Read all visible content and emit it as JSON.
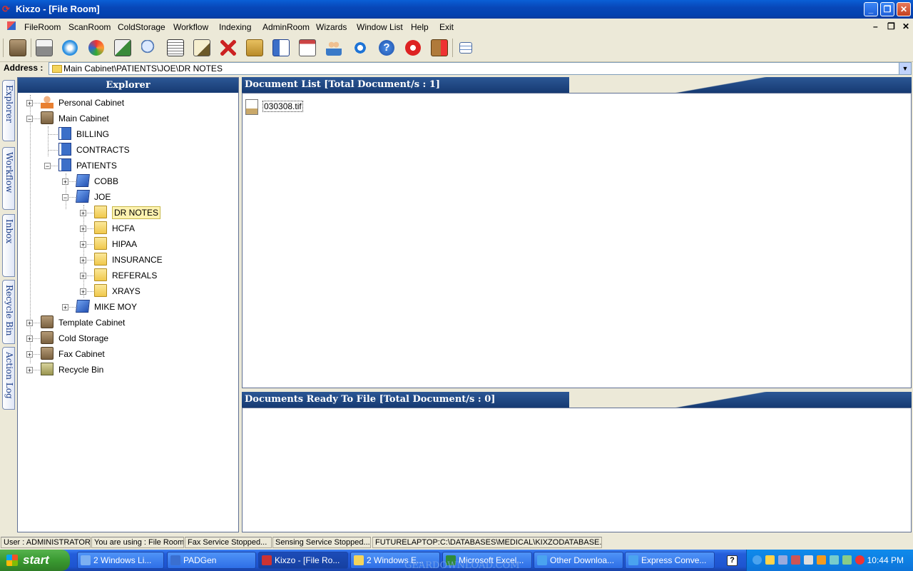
{
  "window": {
    "title": "Kixzo - [File Room]"
  },
  "menu": [
    "FileRoom",
    "ScanRoom",
    "ColdStorage",
    "Workflow",
    "Indexing",
    "AdminRoom",
    "Wizards",
    "Window List",
    "Help",
    "Exit"
  ],
  "address": {
    "label": "Address :",
    "value": "Main Cabinet\\PATIENTS\\JOE\\DR NOTES"
  },
  "side_tabs": [
    "Explorer",
    "Workflow",
    "Inbox",
    "Recycle Bin",
    "Action Log"
  ],
  "explorer": {
    "title": "Explorer",
    "nodes": [
      {
        "label": "Personal Cabinet",
        "icon": "person-icon"
      },
      {
        "label": "Main Cabinet",
        "icon": "cabinet-icon"
      },
      {
        "label": "BILLING",
        "icon": "drawer-icon"
      },
      {
        "label": "CONTRACTS",
        "icon": "drawer-icon"
      },
      {
        "label": "PATIENTS",
        "icon": "drawer-icon"
      },
      {
        "label": "COBB",
        "icon": "book-icon"
      },
      {
        "label": "JOE",
        "icon": "book-icon"
      },
      {
        "label": "DR NOTES",
        "icon": "folder-icon"
      },
      {
        "label": "HCFA",
        "icon": "folder-icon"
      },
      {
        "label": "HIPAA",
        "icon": "folder-icon"
      },
      {
        "label": "INSURANCE",
        "icon": "folder-icon"
      },
      {
        "label": "REFERALS",
        "icon": "folder-icon"
      },
      {
        "label": "XRAYS",
        "icon": "folder-icon"
      },
      {
        "label": "MIKE MOY",
        "icon": "book-icon"
      },
      {
        "label": "Template Cabinet",
        "icon": "cabinet-icon"
      },
      {
        "label": "Cold Storage",
        "icon": "cabinet-icon"
      },
      {
        "label": "Fax Cabinet",
        "icon": "cabinet-icon"
      },
      {
        "label": "Recycle Bin",
        "icon": "recycle-bin-icon"
      }
    ]
  },
  "document_list": {
    "title": "Document List  [Total Document/s : 1]",
    "files": [
      {
        "name": "030308.tif",
        "icon": "tif-file-icon"
      }
    ]
  },
  "ready_to_file": {
    "title": "Documents Ready To File  [Total Document/s : 0]"
  },
  "status": [
    "User : ADMINISTRATOR",
    "You are using : File Room",
    "Fax Service Stopped...",
    "Sensing Service Stopped...",
    "FUTURELAPTOP:C:\\DATABASES\\MEDICAL\\KIXZODATABASE.FDB"
  ],
  "taskbar": {
    "start": "start",
    "buttons": [
      {
        "label": "2 Windows Li...",
        "color": "#7cb0f2"
      },
      {
        "label": "PADGen",
        "color": "#3a6fd0"
      },
      {
        "label": "Kixzo - [File Ro...",
        "color": "#c33"
      },
      {
        "label": "2 Windows E...",
        "color": "#f4d45c"
      },
      {
        "label": "Microsoft Excel...",
        "color": "#2f8a3a"
      },
      {
        "label": "Other Downloa...",
        "color": "#4aa3ef"
      },
      {
        "label": "Express Conve...",
        "color": "#4aa3ef"
      }
    ],
    "time": "10:44 PM"
  },
  "watermark": "GEARDOWNLOAD.COM"
}
